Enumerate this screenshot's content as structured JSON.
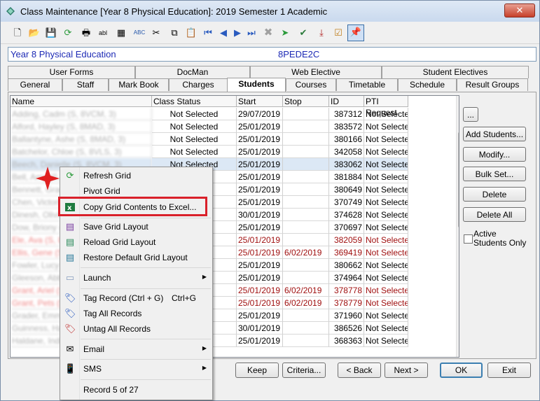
{
  "window": {
    "title": "Class Maintenance  [Year 8 Physical Education]:  2019 Semester 1 Academic",
    "close_label": "✕"
  },
  "infobar": {
    "class_name": "Year 8 Physical Education",
    "class_code": "8PEDE2C"
  },
  "tabs_row1": [
    "User Forms",
    "DocMan",
    "Web Elective",
    "Student Electives"
  ],
  "tabs_row2": [
    "General",
    "Staff",
    "Mark Book",
    "Charges",
    "Students",
    "Courses",
    "Timetable",
    "Schedule",
    "Result Groups"
  ],
  "active_tab": "Students",
  "grid": {
    "columns": [
      "Name",
      "Class Status",
      "Start",
      "Stop",
      "ID",
      "PTI Request"
    ],
    "rows": [
      {
        "name": "Adding, Cadm (S, 8VCM, 3)",
        "status": "Not Selected",
        "start": "29/07/2019",
        "stop": "",
        "id": "387312",
        "pti": "Not Selected",
        "red": false
      },
      {
        "name": "Alford, Hayley (S, 8MAD, 3)",
        "status": "Not Selected",
        "start": "25/01/2019",
        "stop": "",
        "id": "383572",
        "pti": "Not Selected",
        "red": false
      },
      {
        "name": "Ballantyne, Ashe (S, 8MAD, 3)",
        "status": "Not Selected",
        "start": "25/01/2019",
        "stop": "",
        "id": "380166",
        "pti": "Not Selected",
        "red": false
      },
      {
        "name": "Batchelor, Chloe (S, 8VLS, 3)",
        "status": "Not Selected",
        "start": "25/01/2019",
        "stop": "",
        "id": "342058",
        "pti": "Not Selected",
        "red": false
      },
      {
        "name": "Beech, Danielle (S, 8VCM, 3)",
        "status": "Not Selected",
        "start": "25/01/2019",
        "stop": "",
        "id": "383062",
        "pti": "Not Selected",
        "red": false
      },
      {
        "name": "Bell, Amy (S, 8VCM, 3)",
        "status": "ed",
        "start": "25/01/2019",
        "stop": "",
        "id": "381884",
        "pti": "Not Selected",
        "red": false
      },
      {
        "name": "Bennett, Grace (S, 8VLS)",
        "status": "ed",
        "start": "25/01/2019",
        "stop": "",
        "id": "380649",
        "pti": "Not Selected",
        "red": false
      },
      {
        "name": "Chen, Victoria (S, 8MAD)",
        "status": "ed",
        "start": "25/01/2019",
        "stop": "",
        "id": "370749",
        "pti": "Not Selected",
        "red": false
      },
      {
        "name": "Dinesh, Olivia (S, 8VLS)",
        "status": "ed",
        "start": "30/01/2019",
        "stop": "",
        "id": "374628",
        "pti": "Not Selected",
        "red": false
      },
      {
        "name": "Dow, Briony (S, 8VCM)",
        "status": "ed",
        "start": "25/01/2019",
        "stop": "",
        "id": "370697",
        "pti": "Not Selected",
        "red": false
      },
      {
        "name": "Ele, Ava (S, 8VCM)",
        "status": "SCHOC",
        "start": "25/01/2019",
        "stop": "",
        "id": "382059",
        "pti": "Not Selected",
        "red": true
      },
      {
        "name": "Ellis, Gene (S, 8MAD)",
        "status": "T CLASS",
        "start": "25/01/2019",
        "stop": "6/02/2019",
        "id": "369419",
        "pti": "Not Selected",
        "red": true
      },
      {
        "name": "Fowler, Lucy (S, 8VLS)",
        "status": "ed",
        "start": "25/01/2019",
        "stop": "",
        "id": "380662",
        "pti": "Not Selected",
        "red": false
      },
      {
        "name": "Gleeson, Abby (S, 8VCM)",
        "status": "ed",
        "start": "25/01/2019",
        "stop": "",
        "id": "374964",
        "pti": "Not Selected",
        "red": false
      },
      {
        "name": "Grant, Ariel (S, 8MAD)",
        "status": "T CLASS",
        "start": "25/01/2019",
        "stop": "6/02/2019",
        "id": "378778",
        "pti": "Not Selected",
        "red": true
      },
      {
        "name": "Grant, Pets (S, 8MAD)",
        "status": "T CLASS",
        "start": "25/01/2019",
        "stop": "6/02/2019",
        "id": "378779",
        "pti": "Not Selected",
        "red": true
      },
      {
        "name": "Grader, Emma (S, 8VLS)",
        "status": "ed",
        "start": "25/01/2019",
        "stop": "",
        "id": "371960",
        "pti": "Not Selected",
        "red": false
      },
      {
        "name": "Guinness, Harriet (S, 8VCM)",
        "status": "ed",
        "start": "30/01/2019",
        "stop": "",
        "id": "386526",
        "pti": "Not Selected",
        "red": false
      },
      {
        "name": "Haldane, Indie (S, 8VLS)",
        "status": "ed",
        "start": "25/01/2019",
        "stop": "",
        "id": "368363",
        "pti": "Not Selected",
        "red": false
      }
    ]
  },
  "side_buttons": {
    "ellipsis": "...",
    "add": "Add Students...",
    "modify": "Modify...",
    "bulk": "Bulk Set...",
    "delete": "Delete",
    "delete_all": "Delete All",
    "active_only": "Active Students Only"
  },
  "bottom_buttons": {
    "keep": "Keep",
    "criteria": "Criteria...",
    "back": "< Back",
    "next": "Next >",
    "ok": "OK",
    "exit": "Exit"
  },
  "menu": {
    "refresh": "Refresh Grid",
    "pivot": "Pivot Grid",
    "copy_excel": "Copy Grid Contents to Excel...",
    "save_layout": "Save Grid Layout",
    "reload_layout": "Reload Grid Layout",
    "restore_layout": "Restore Default Grid Layout",
    "launch": "Launch",
    "tag_record": "Tag Record (Ctrl + G)",
    "tag_shortcut": "Ctrl+G",
    "tag_all": "Tag All Records",
    "untag_all": "Untag All Records",
    "email": "Email",
    "sms": "SMS",
    "record_status": "Record 5 of 27"
  },
  "colors": {
    "accent_red": "#d9202a",
    "link_blue": "#1d2ab5",
    "inactive_text": "#a01010"
  }
}
